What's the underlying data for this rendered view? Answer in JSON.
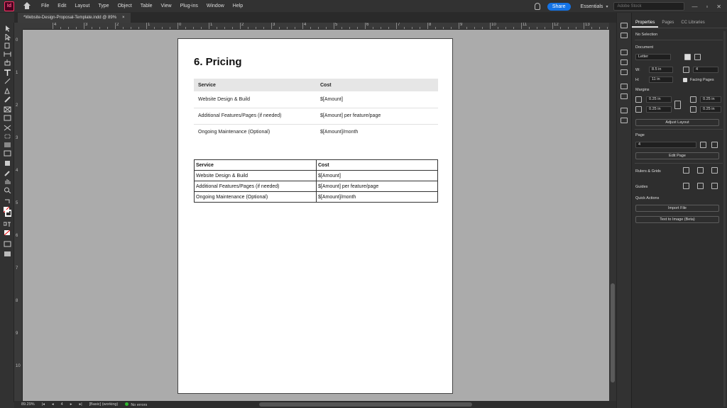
{
  "app": {
    "logo": "Id"
  },
  "menu": [
    "File",
    "Edit",
    "Layout",
    "Type",
    "Object",
    "Table",
    "View",
    "Plug-ins",
    "Window",
    "Help"
  ],
  "header": {
    "share_label": "Share",
    "workspace": "Essentials",
    "search_placeholder": "Adobe Stock"
  },
  "doc_tab": {
    "title": "*Website-Design-Proposal-Template.indd @ 89%",
    "close": "×"
  },
  "ruler": {
    "h_labels": [
      "0",
      "1",
      "2",
      "3",
      "4",
      "5",
      "6",
      "7",
      "8",
      "9",
      "10",
      "11",
      "12",
      "13"
    ],
    "v_labels": [
      "0",
      "1",
      "2",
      "3",
      "4",
      "5",
      "6",
      "7",
      "8",
      "9",
      "10",
      "11"
    ]
  },
  "document": {
    "heading": "6. Pricing",
    "table1": {
      "headers": [
        "Service",
        "Cost"
      ],
      "rows": [
        [
          "Website Design & Build",
          "$[Amount]"
        ],
        [
          "Additional Features/Pages (if needed)",
          "$[Amount] per feature/page"
        ],
        [
          "Ongoing Maintenance (Optional)",
          "$[Amount]/month"
        ]
      ]
    },
    "table2": {
      "headers": [
        "Service",
        "Cost"
      ],
      "rows": [
        [
          "Website Design & Build",
          "$[Amount]"
        ],
        [
          "Additional Features/Pages (if needed)",
          "$[Amount] per feature/page"
        ],
        [
          "Ongoing Maintenance (Optional)",
          "$[Amount]/month"
        ]
      ]
    }
  },
  "statusbar": {
    "zoom": "89.29%",
    "page": "4",
    "style": "[Basic] (working)",
    "errors": "No errors"
  },
  "panel": {
    "tabs": [
      "Properties",
      "Pages",
      "CC Libraries"
    ],
    "selection": "No Selection",
    "document_label": "Document",
    "page_size": "Letter",
    "width_label": "W:",
    "width": "8.5 in",
    "height_label": "H:",
    "height": "11 in",
    "pages_count": "4",
    "facing_pages": "Facing Pages",
    "margins_label": "Margins",
    "margin_top": "0.25 in",
    "margin_bottom": "0.25 in",
    "margin_left": "0.25 in",
    "margin_right": "0.25 in",
    "adjust_layout": "Adjust Layout",
    "page_label": "Page",
    "page_value": "4",
    "edit_page": "Edit Page",
    "rulers_grids": "Rulers & Grids",
    "guides": "Guides",
    "quick_actions": "Quick Actions",
    "import_file": "Import File",
    "text_to_image": "Text to Image (Beta)"
  },
  "colors": {
    "accent": "#1473e6",
    "logo_bg": "#49021f",
    "logo_fg": "#ff3366",
    "ok": "#2eb82e"
  }
}
